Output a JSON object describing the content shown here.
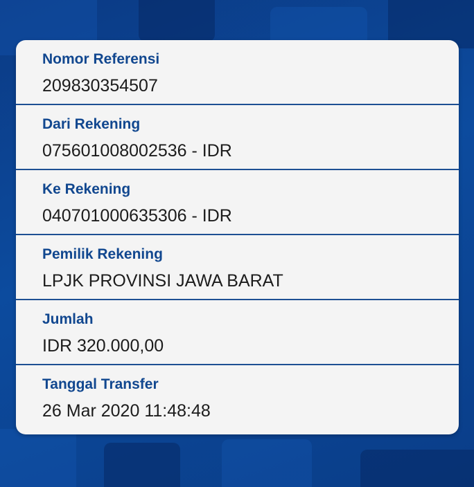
{
  "details": {
    "items": [
      {
        "label": "Nomor Referensi",
        "value": "209830354507"
      },
      {
        "label": "Dari Rekening",
        "value": "075601008002536 - IDR"
      },
      {
        "label": "Ke Rekening",
        "value": "040701000635306 - IDR"
      },
      {
        "label": "Pemilik Rekening",
        "value": "LPJK PROVINSI JAWA BARAT"
      },
      {
        "label": "Jumlah",
        "value": "IDR 320.000,00"
      },
      {
        "label": "Tanggal Transfer",
        "value": "26 Mar 2020 11:48:48"
      }
    ]
  },
  "colors": {
    "label": "#11478f",
    "value": "#1c1c1c",
    "divider": "#1d4f93",
    "card": "#f4f4f4",
    "background": "#0a3f8c"
  }
}
